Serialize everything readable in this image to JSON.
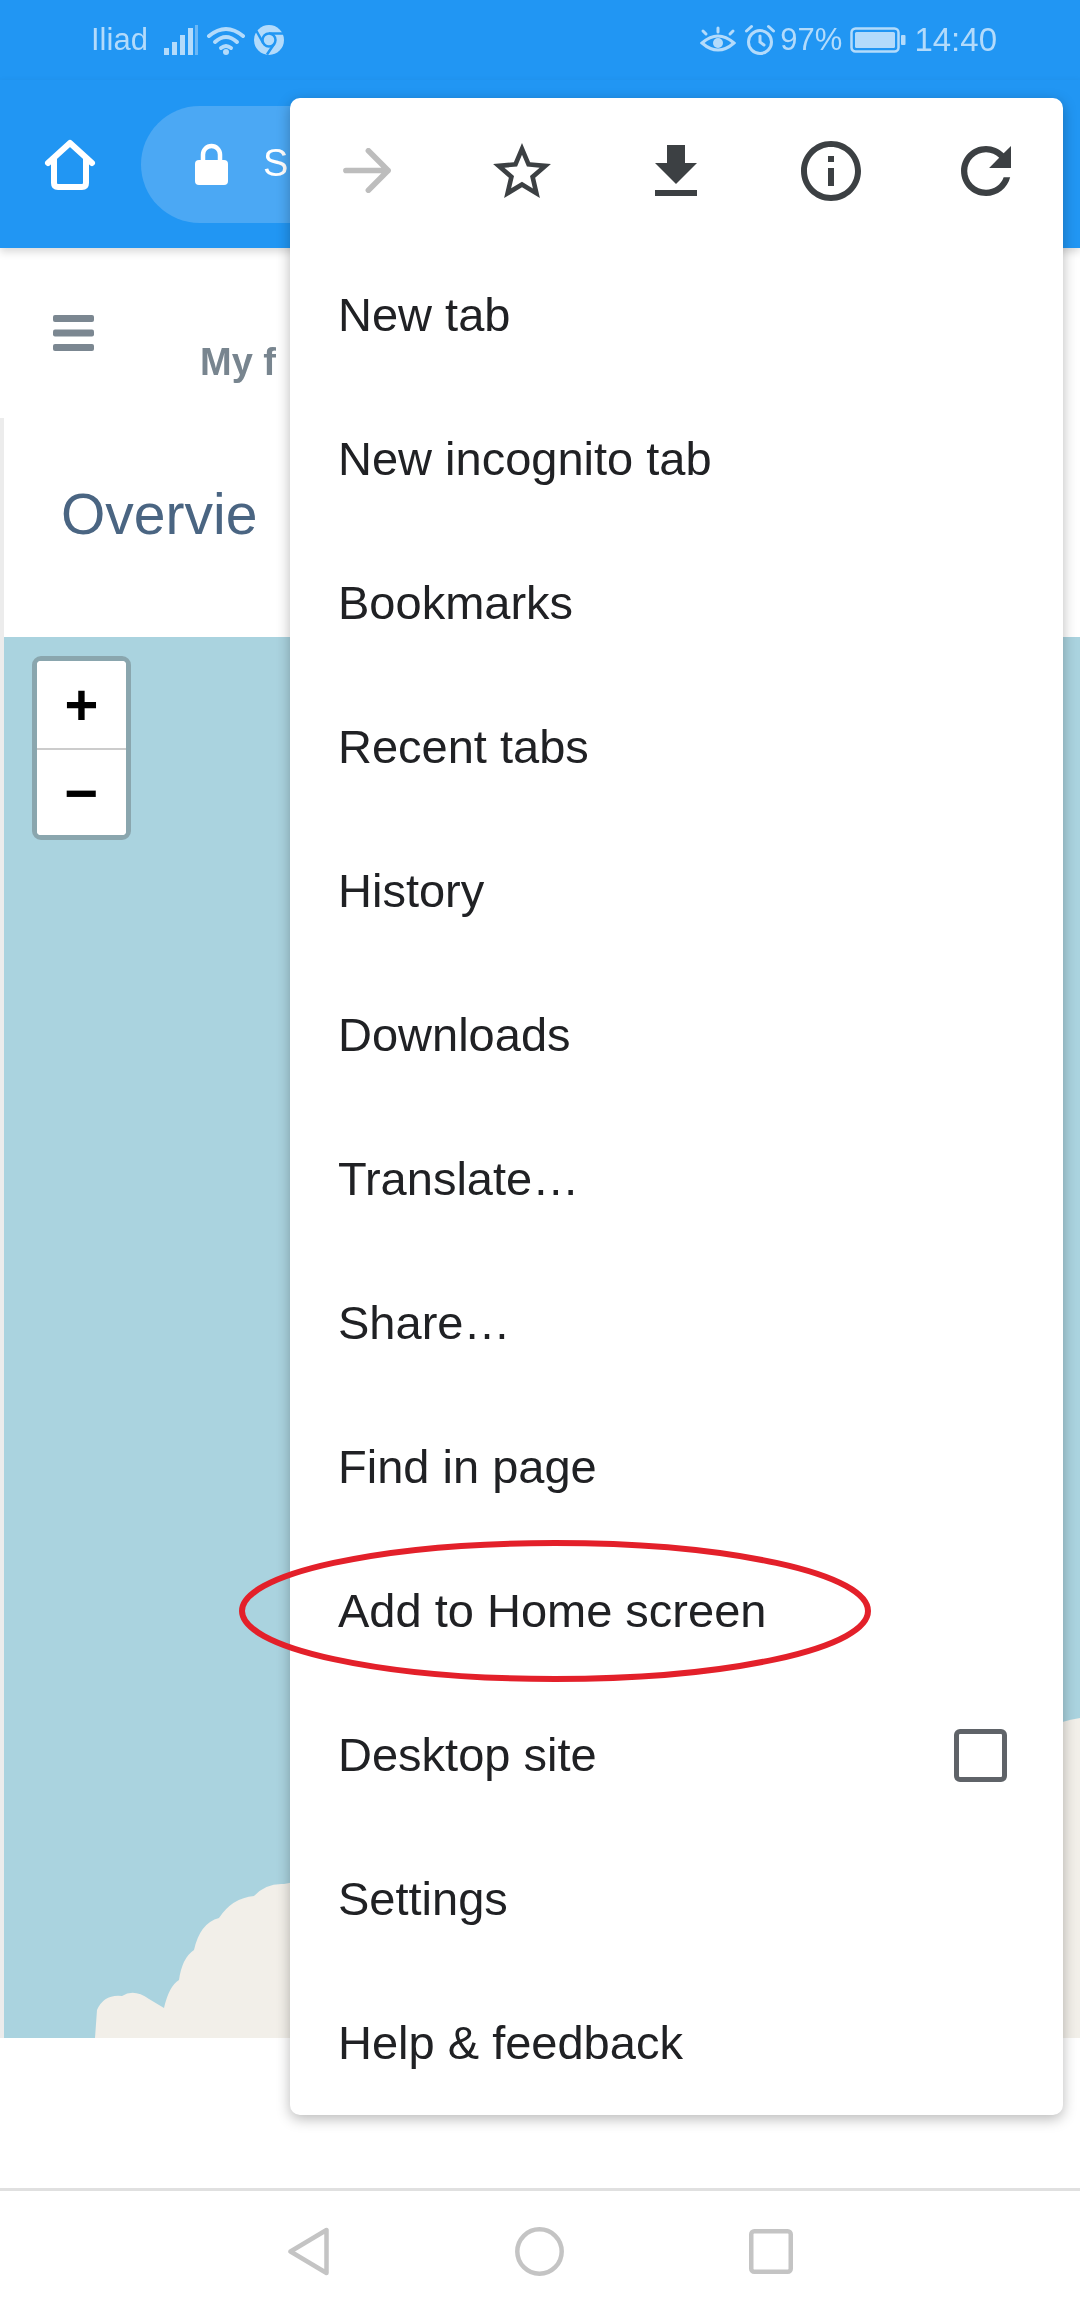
{
  "status_bar": {
    "carrier": "Iliad",
    "battery": "97%",
    "time": "14:40"
  },
  "toolbar": {
    "url": "S"
  },
  "site_header": {
    "title": "My f"
  },
  "heading": "Overvie",
  "map": {
    "zoom_in": "+",
    "zoom_out": "−"
  },
  "menu": {
    "actions": [
      {
        "kind": "forward",
        "disabled": true
      },
      {
        "kind": "bookmark",
        "disabled": false
      },
      {
        "kind": "download",
        "disabled": false
      },
      {
        "kind": "info",
        "disabled": false
      },
      {
        "kind": "reload",
        "disabled": false
      }
    ],
    "items": [
      {
        "label": "New tab",
        "kind": "plain",
        "circled": false
      },
      {
        "label": "New incognito tab",
        "kind": "plain",
        "circled": false
      },
      {
        "label": "Bookmarks",
        "kind": "plain",
        "circled": false
      },
      {
        "label": "Recent tabs",
        "kind": "plain",
        "circled": false
      },
      {
        "label": "History",
        "kind": "plain",
        "circled": false
      },
      {
        "label": "Downloads",
        "kind": "plain",
        "circled": false
      },
      {
        "label": "Translate…",
        "kind": "plain",
        "circled": false
      },
      {
        "label": "Share…",
        "kind": "plain",
        "circled": false
      },
      {
        "label": "Find in page",
        "kind": "plain",
        "circled": false
      },
      {
        "label": "Add to Home screen",
        "kind": "plain",
        "circled": true
      },
      {
        "label": "Desktop site",
        "kind": "checkbox",
        "checked": false,
        "circled": false
      },
      {
        "label": "Settings",
        "kind": "plain",
        "circled": false
      },
      {
        "label": "Help & feedback",
        "kind": "plain",
        "circled": false
      }
    ]
  }
}
